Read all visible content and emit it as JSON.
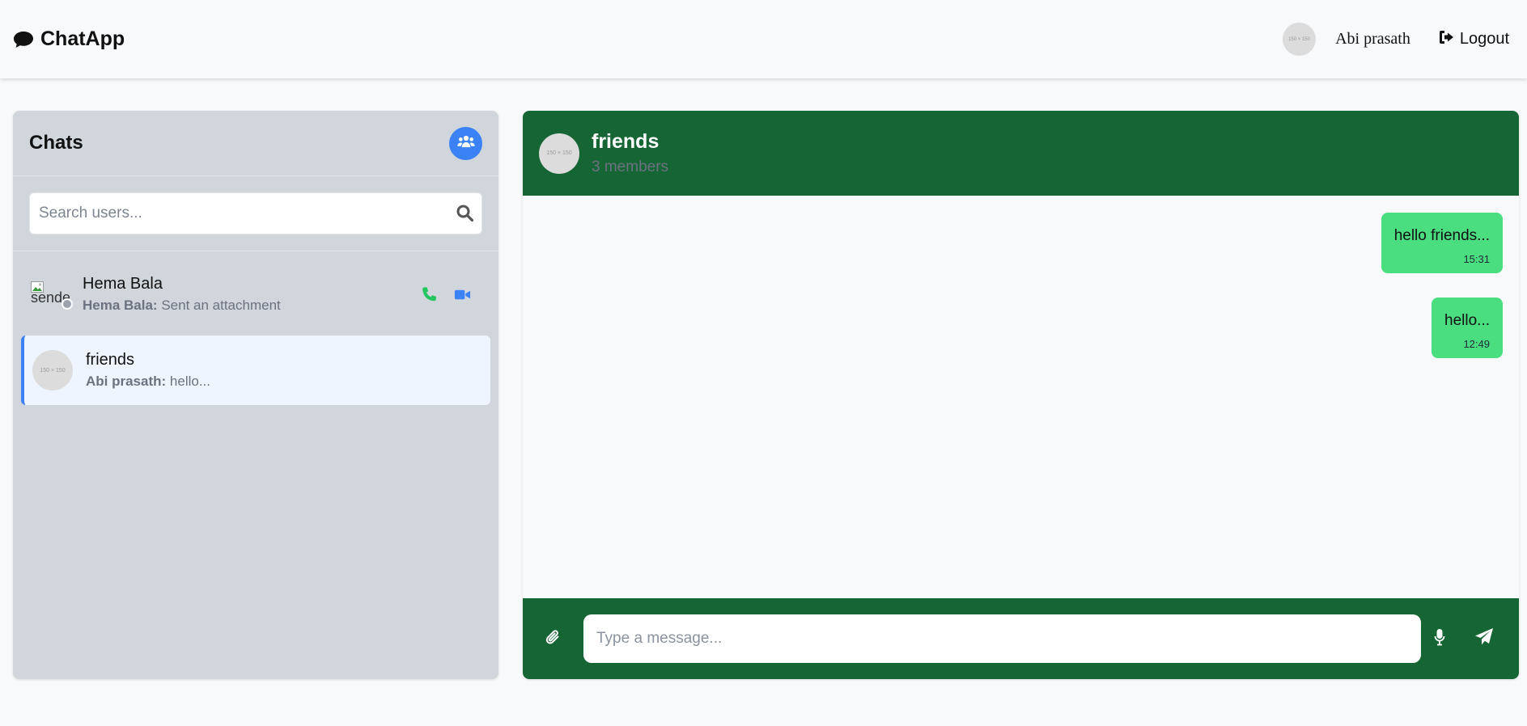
{
  "navbar": {
    "brand": "ChatApp",
    "avatar_text": "150 × 150",
    "user_name": "Abi prasath",
    "logout_label": "Logout"
  },
  "sidebar": {
    "title": "Chats",
    "search_placeholder": "Search users...",
    "chats": [
      {
        "name": "Hema Bala",
        "avatar_alt": "sender",
        "preview_sender": "Hema Bala:",
        "preview_text": " Sent an attachment",
        "status": "offline"
      },
      {
        "name": "friends",
        "avatar_text": "150 × 150",
        "preview_sender": "Abi prasath:",
        "preview_text": " hello...",
        "active": true
      }
    ]
  },
  "chat": {
    "name": "friends",
    "members": "3 members",
    "avatar_text": "150 × 150",
    "messages": [
      {
        "text": "hello friends...",
        "time": "15:31"
      },
      {
        "text": "hello...",
        "time": "12:49"
      }
    ],
    "input_placeholder": "Type a message..."
  },
  "colors": {
    "accent": "#3b82f6",
    "header_green": "#166534",
    "bubble_green": "#4ade80",
    "sidebar_bg": "#d1d5dc",
    "active_chat_bg": "#eef5ff",
    "call_green": "#22c55e"
  },
  "icons": {
    "brand": "comment-icon",
    "logout": "sign-out-icon",
    "new_group": "users-icon",
    "search": "search-icon",
    "call": "phone-icon",
    "video": "video-icon",
    "attach": "paperclip-icon",
    "mic": "microphone-icon",
    "send": "paper-plane-icon"
  }
}
